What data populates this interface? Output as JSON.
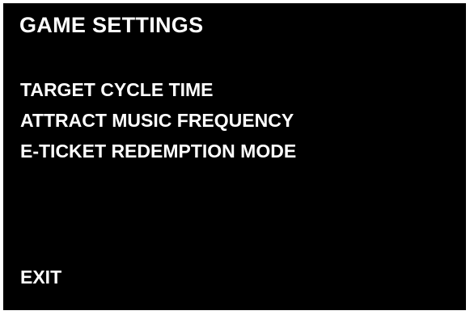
{
  "screen": {
    "title": "GAME SETTINGS",
    "background_color": "#000000",
    "text_color": "#ffffff"
  },
  "menu": {
    "items": [
      {
        "label": "TARGET CYCLE TIME"
      },
      {
        "label": "ATTRACT MUSIC FREQUENCY"
      },
      {
        "label": "E-TICKET REDEMPTION MODE"
      }
    ],
    "exit_label": "EXIT"
  }
}
